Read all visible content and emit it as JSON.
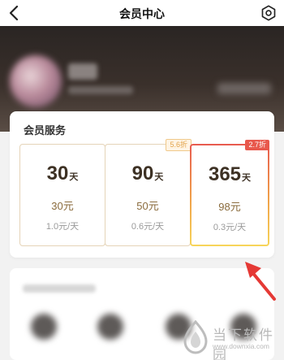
{
  "header": {
    "title": "会员中心"
  },
  "card": {
    "title": "会员服务",
    "plans": [
      {
        "num": "30",
        "unit": "天",
        "price": "30元",
        "per_day": "1.0元/天",
        "badge": ""
      },
      {
        "num": "90",
        "unit": "天",
        "price": "50元",
        "per_day": "0.6元/天",
        "badge": "5.6折"
      },
      {
        "num": "365",
        "unit": "天",
        "price": "98元",
        "per_day": "0.3元/天",
        "badge": "2.7折"
      }
    ]
  },
  "watermark": {
    "brand": "当下软件园",
    "url": "www.downxia.com"
  },
  "icons": {
    "back": "chevron-left-icon",
    "settings": "gear-icon",
    "arrow": "red-arrow-icon"
  },
  "colors": {
    "gold_text": "#8a6b3c",
    "selected_gradient_top": "#e85a4f",
    "selected_gradient_bottom": "#f7d55a",
    "arrow_red": "#e53935"
  }
}
